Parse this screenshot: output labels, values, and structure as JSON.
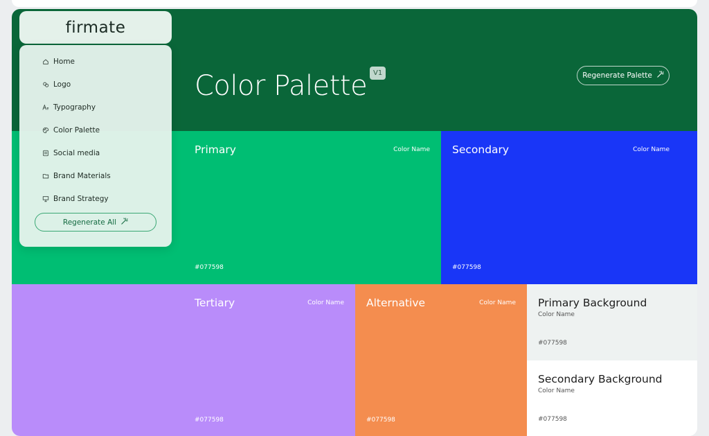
{
  "app": {
    "brand": "firmate"
  },
  "colors": {
    "header_bg": "#0a6639",
    "accent": "#15c47a"
  },
  "header": {
    "title": "Color Palette",
    "version": "V1",
    "regen_label": "Regenerate Palette"
  },
  "sidebar": {
    "items": [
      {
        "label": "Home",
        "icon": "home-icon"
      },
      {
        "label": "Logo",
        "icon": "logo-icon"
      },
      {
        "label": "Typography",
        "icon": "typography-icon"
      },
      {
        "label": "Color Palette",
        "icon": "palette-icon"
      },
      {
        "label": "Social media",
        "icon": "social-media-icon"
      },
      {
        "label": "Brand Materials",
        "icon": "folder-icon"
      },
      {
        "label": "Brand Strategy",
        "icon": "strategy-icon"
      }
    ],
    "regen_all": "Regenerate All"
  },
  "swatches": {
    "primary": {
      "name": "Primary",
      "color_name": "Color Name",
      "hex": "#077598",
      "color": "#00be73"
    },
    "secondary": {
      "name": "Secondary",
      "color_name": "Color Name",
      "hex": "#077598",
      "color": "#1936f7"
    },
    "tertiary": {
      "name": "Tertiary",
      "color_name": "Color Name",
      "hex": "#077598",
      "color": "#b98cfa"
    },
    "alternative": {
      "name": "Alternative",
      "color_name": "Color Name",
      "hex": "#077598",
      "color": "#f48d4f"
    },
    "primary_bg": {
      "name": "Primary Background",
      "color_name": "Color Name",
      "hex": "#077598",
      "color": "#eef2f1"
    },
    "secondary_bg": {
      "name": "Secondary Background",
      "color_name": "Color Name",
      "hex": "#077598",
      "color": "#ffffff"
    }
  }
}
